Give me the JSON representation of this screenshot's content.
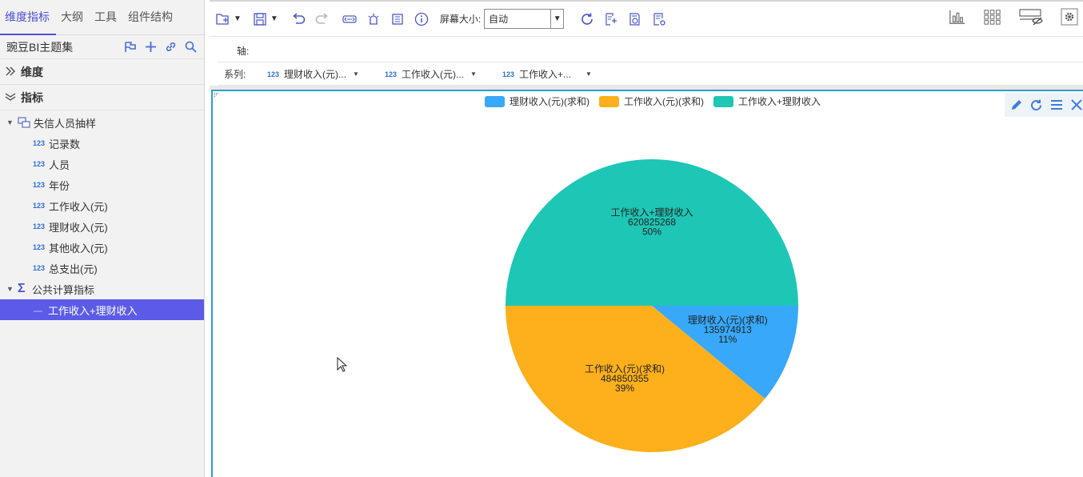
{
  "left_panel": {
    "tabs": [
      {
        "label": "维度指标",
        "active": true
      },
      {
        "label": "大纲",
        "active": false
      },
      {
        "label": "工具",
        "active": false
      },
      {
        "label": "组件结构",
        "active": false
      }
    ],
    "subject_title": "豌豆BI主题集",
    "dimension_section": "维度",
    "metric_section": "指标",
    "groups": [
      {
        "label": "失信人员抽样",
        "items": [
          "记录数",
          "人员",
          "年份",
          "工作收入(元)",
          "理财收入(元)",
          "其他收入(元)",
          "总支出(元)"
        ]
      },
      {
        "label": "公共计算指标",
        "items": [
          "工作收入+理财收入"
        ]
      }
    ],
    "num_badge": "123"
  },
  "toolbar": {
    "screen_size_label": "屏幕大小:",
    "screen_size_value": "自动"
  },
  "axis_label": "轴:",
  "series_label": "系列:",
  "series_items": [
    "理财收入(元)...",
    "工作收入(元)...",
    "工作收入+..."
  ],
  "colors": {
    "accent": "#5b5be8",
    "blue": "#37a8fa",
    "orange": "#fdb01b",
    "teal": "#1ec6b6",
    "chart_border": "#2da0c7"
  },
  "chart_data": {
    "type": "pie",
    "legend_position": "top",
    "slices": [
      {
        "name": "理财收入(元)(求和)",
        "value": 135974913,
        "percent": "11%",
        "color": "#37a8fa"
      },
      {
        "name": "工作收入(元)(求和)",
        "value": 484850355,
        "percent": "39%",
        "color": "#fdb01b"
      },
      {
        "name": "工作收入+理财收入",
        "value": 620825268,
        "percent": "50%",
        "color": "#1ec6b6"
      }
    ]
  }
}
